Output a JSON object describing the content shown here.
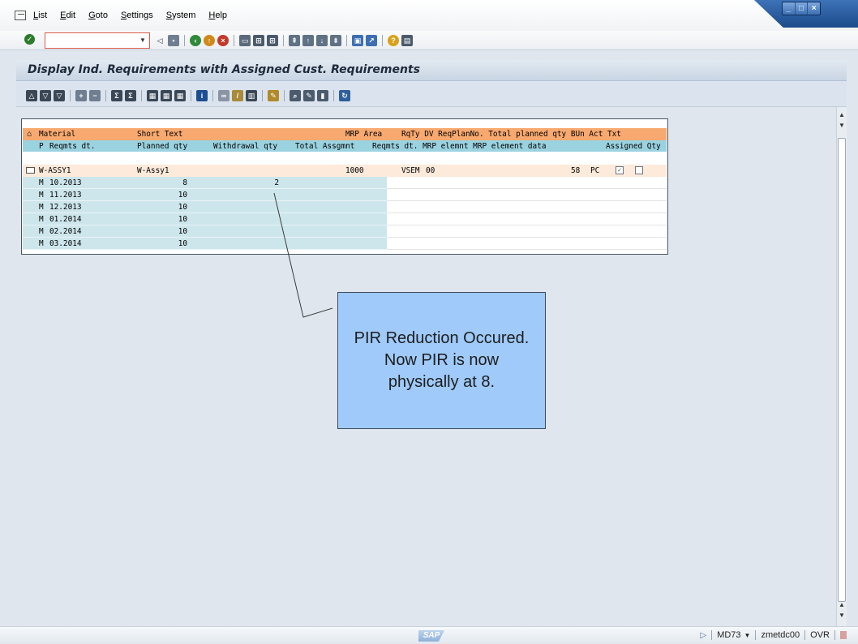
{
  "menu": {
    "items": [
      {
        "label": "List",
        "u": "L",
        "rest": "ist"
      },
      {
        "label": "Edit",
        "u": "E",
        "rest": "dit"
      },
      {
        "label": "Goto",
        "u": "G",
        "rest": "oto"
      },
      {
        "label": "Settings",
        "u": "S",
        "rest": "ettings"
      },
      {
        "label": "System",
        "u": "S",
        "rest": "ystem"
      },
      {
        "label": "Help",
        "u": "H",
        "rest": "elp"
      }
    ]
  },
  "command_field": {
    "value": "",
    "placeholder": ""
  },
  "title": "Display Ind. Requirements with Assigned Cust. Requirements",
  "grid": {
    "header1": {
      "material": "Material",
      "short_text": "Short Text",
      "mrp_area": "MRP Area",
      "rest": "RqTy DV ReqPlanNo. Total planned qty BUn Act Txt"
    },
    "header2": {
      "p": "P",
      "reqmts_dt": "Reqmts dt.",
      "planned_qty": "Planned qty",
      "withdrawal_qty": "Withdrawal qty",
      "total_assgmnt": "Total Assgmnt",
      "rest": "Reqmts dt. MRP elemnt MRP element data",
      "assigned_qty": "Assigned Qty"
    },
    "material_row": {
      "material": "W-ASSY1",
      "short_text": "W-Assy1",
      "mrp_area": "1000",
      "rqty": "VSEM",
      "dv": "00",
      "total_planned": "58",
      "bun": "PC",
      "act": true,
      "txt": false
    },
    "rows": [
      {
        "p": "M",
        "date": "10.2013",
        "planned": "8",
        "withdrawal": "2"
      },
      {
        "p": "M",
        "date": "11.2013",
        "planned": "10",
        "withdrawal": ""
      },
      {
        "p": "M",
        "date": "12.2013",
        "planned": "10",
        "withdrawal": ""
      },
      {
        "p": "M",
        "date": "01.2014",
        "planned": "10",
        "withdrawal": ""
      },
      {
        "p": "M",
        "date": "02.2014",
        "planned": "10",
        "withdrawal": ""
      },
      {
        "p": "M",
        "date": "03.2014",
        "planned": "10",
        "withdrawal": ""
      }
    ]
  },
  "callout": {
    "text": "PIR Reduction Occured. Now PIR is now physically at 8."
  },
  "status": {
    "logo": "SAP",
    "transaction": "MD73",
    "server": "zmetdc00",
    "mode": "OVR"
  },
  "colors": {
    "header1_bg": "#f8a96f",
    "header2_bg": "#9ad2e0",
    "material_row_bg": "#fdeadb",
    "sub_row_bg": "#cde6ec",
    "callout_bg": "#9fcaf9"
  }
}
